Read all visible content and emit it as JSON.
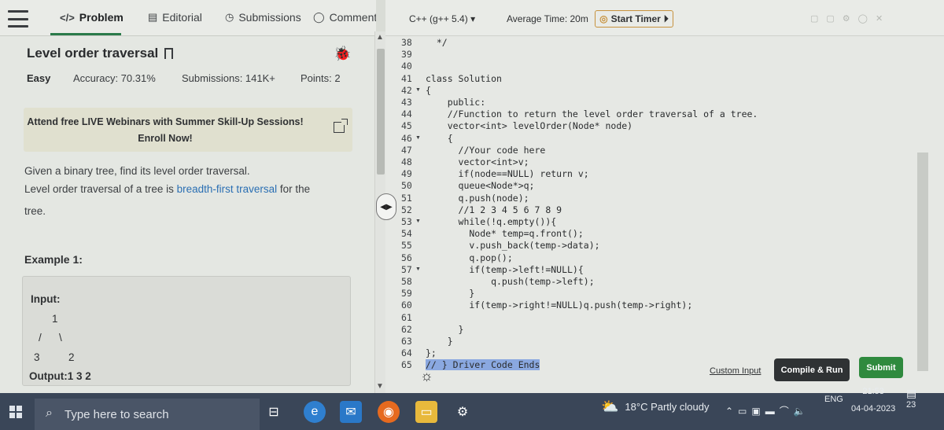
{
  "problem_tabs": [
    {
      "label": "Problem",
      "icon": "code-icon"
    },
    {
      "label": "Editorial",
      "icon": "document-icon"
    },
    {
      "label": "Submissions",
      "icon": "clock-icon"
    },
    {
      "label": "Comments",
      "icon": "comment-icon"
    }
  ],
  "problem": {
    "title": "Level order traversal",
    "difficulty": "Easy",
    "accuracy": "Accuracy: 70.31%",
    "submissions": "Submissions: 141K+",
    "points": "Points: 2",
    "banner_line1": "Attend free LIVE Webinars with Summer Skill-Up Sessions!",
    "banner_line2": "Enroll Now!",
    "desc_line1": "Given a binary tree, find its level order traversal.",
    "desc_line2_pre": "Level order traversal of a tree is ",
    "desc_line2_link": "breadth-first traversal",
    "desc_line2_post": " for the",
    "desc_line3": "tree.",
    "example_title": "Example 1:",
    "input_label": "Input:",
    "tree_root": "1",
    "tree_left_edge": "/",
    "tree_right_edge": "\\",
    "tree_left": "3",
    "tree_right": "2",
    "output_label": "Output:1 3 2"
  },
  "editor": {
    "language": "C++ (g++ 5.4)",
    "language_caret": "▾",
    "avg_time": "Average Time: 20m",
    "timer_label": "Start Timer",
    "lines": [
      {
        "n": "38",
        "text": "  */"
      },
      {
        "n": "39",
        "text": ""
      },
      {
        "n": "40",
        "text": ""
      },
      {
        "n": "41",
        "text": "class Solution"
      },
      {
        "n": "42",
        "text": "{"
      },
      {
        "n": "43",
        "text": "    public:"
      },
      {
        "n": "44",
        "text": "    //Function to return the level order traversal of a tree."
      },
      {
        "n": "45",
        "text": "    vector<int> levelOrder(Node* node)"
      },
      {
        "n": "46",
        "text": "    {"
      },
      {
        "n": "47",
        "text": "      //Your code here"
      },
      {
        "n": "48",
        "text": "      vector<int>v;"
      },
      {
        "n": "49",
        "text": "      if(node==NULL) return v;"
      },
      {
        "n": "50",
        "text": "      queue<Node*>q;"
      },
      {
        "n": "51",
        "text": "      q.push(node);"
      },
      {
        "n": "52",
        "text": "      //1 2 3 4 5 6 7 8 9"
      },
      {
        "n": "53",
        "text": "      while(!q.empty()){"
      },
      {
        "n": "54",
        "text": "        Node* temp=q.front();"
      },
      {
        "n": "55",
        "text": "        v.push_back(temp->data);"
      },
      {
        "n": "56",
        "text": "        q.pop();"
      },
      {
        "n": "57",
        "text": "        if(temp->left!=NULL){"
      },
      {
        "n": "58",
        "text": "            q.push(temp->left);"
      },
      {
        "n": "59",
        "text": "        }"
      },
      {
        "n": "60",
        "text": "        if(temp->right!=NULL)q.push(temp->right);"
      },
      {
        "n": "61",
        "text": ""
      },
      {
        "n": "62",
        "text": "      }"
      },
      {
        "n": "63",
        "text": "    }"
      },
      {
        "n": "64",
        "text": "};"
      },
      {
        "n": "65",
        "text": "// } Driver Code Ends"
      }
    ],
    "custom_input": "Custom Input",
    "compile_run": "Compile & Run",
    "submit": "Submit"
  },
  "taskbar": {
    "search_placeholder": "Type here to search",
    "weather": "18°C  Partly cloudy",
    "language": "ENG",
    "time": "21:53",
    "date": "04-04-2023",
    "notification_count": "23"
  }
}
